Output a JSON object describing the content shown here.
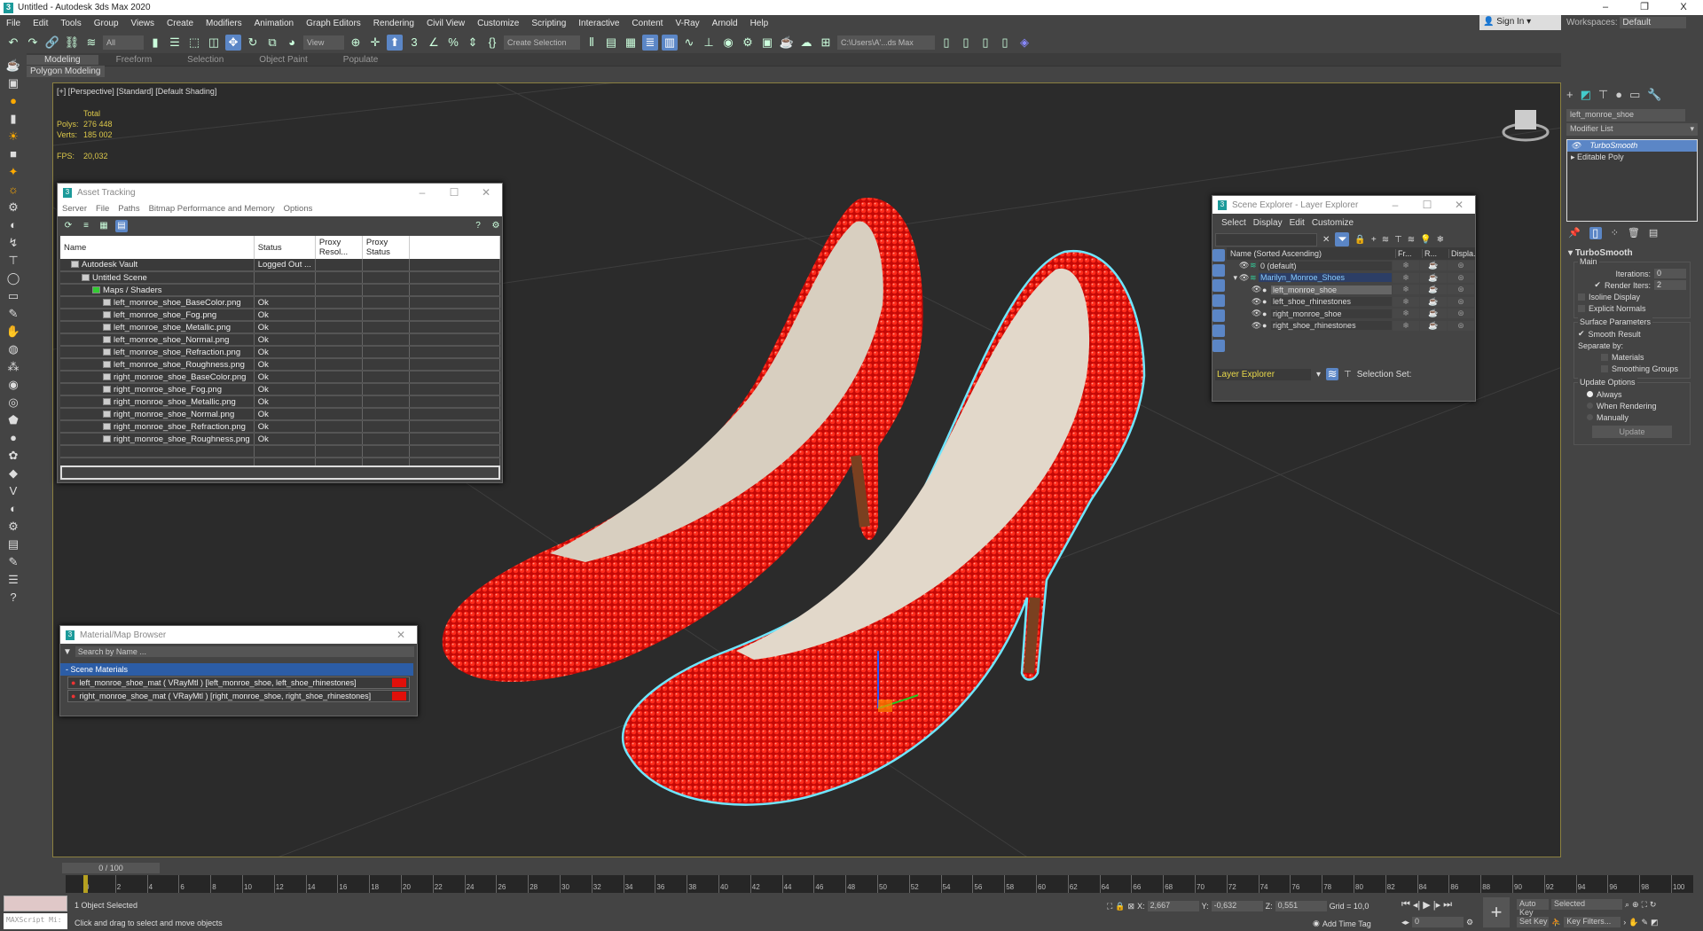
{
  "app": {
    "title": "Untitled - Autodesk 3ds Max 2020",
    "logo": "3",
    "controls": [
      "–",
      "❐",
      "X"
    ]
  },
  "menu": [
    "File",
    "Edit",
    "Tools",
    "Group",
    "Views",
    "Create",
    "Modifiers",
    "Animation",
    "Graph Editors",
    "Rendering",
    "Civil View",
    "Customize",
    "Scripting",
    "Interactive",
    "Content",
    "V-Ray",
    "Arnold",
    "Help"
  ],
  "account": {
    "sign_in": "Sign In",
    "workspaces_label": "Workspaces:",
    "workspace": "Default"
  },
  "toolbar": {
    "filter": "All",
    "ref_coord": "View",
    "selection_set": "Create Selection Se",
    "project_path": "C:\\Users\\A'...ds Max 2020"
  },
  "ribbon": {
    "tabs": [
      "Modeling",
      "Freeform",
      "Selection",
      "Object Paint",
      "Populate"
    ],
    "active": "Modeling",
    "sub": "Polygon Modeling"
  },
  "viewport": {
    "label": "[+] [Perspective] [Standard] [Default Shading]",
    "stats": {
      "header": "Total",
      "polys_label": "Polys:",
      "polys": "276 448",
      "verts_label": "Verts:",
      "verts": "185 002",
      "fps_label": "FPS:",
      "fps": "20,032"
    },
    "shoe_color": "#e0100a",
    "selection_outline": "#6fe6ff"
  },
  "asset_tracking": {
    "title": "Asset Tracking",
    "menu": [
      "Server",
      "File",
      "Paths",
      "Bitmap Performance and Memory",
      "Options"
    ],
    "columns": [
      "Name",
      "Status",
      "Proxy Resol...",
      "Proxy Status"
    ],
    "rows": [
      {
        "name": "Autodesk Vault",
        "status": "Logged Out ...",
        "level": 1
      },
      {
        "name": "Untitled Scene",
        "status": "",
        "level": 2
      },
      {
        "name": "Maps / Shaders",
        "status": "",
        "level": 3
      },
      {
        "name": "left_monroe_shoe_BaseColor.png",
        "status": "Ok",
        "level": 4
      },
      {
        "name": "left_monroe_shoe_Fog.png",
        "status": "Ok",
        "level": 4
      },
      {
        "name": "left_monroe_shoe_Metallic.png",
        "status": "Ok",
        "level": 4
      },
      {
        "name": "left_monroe_shoe_Normal.png",
        "status": "Ok",
        "level": 4
      },
      {
        "name": "left_monroe_shoe_Refraction.png",
        "status": "Ok",
        "level": 4
      },
      {
        "name": "left_monroe_shoe_Roughness.png",
        "status": "Ok",
        "level": 4
      },
      {
        "name": "right_monroe_shoe_BaseColor.png",
        "status": "Ok",
        "level": 4
      },
      {
        "name": "right_monroe_shoe_Fog.png",
        "status": "Ok",
        "level": 4
      },
      {
        "name": "right_monroe_shoe_Metallic.png",
        "status": "Ok",
        "level": 4
      },
      {
        "name": "right_monroe_shoe_Normal.png",
        "status": "Ok",
        "level": 4
      },
      {
        "name": "right_monroe_shoe_Refraction.png",
        "status": "Ok",
        "level": 4
      },
      {
        "name": "right_monroe_shoe_Roughness.png",
        "status": "Ok",
        "level": 4
      }
    ]
  },
  "scene_explorer": {
    "title": "Scene Explorer - Layer Explorer",
    "menu": [
      "Select",
      "Display",
      "Edit",
      "Customize"
    ],
    "columns": [
      "Name (Sorted Ascending)",
      "Fr...",
      "R...",
      "Displa..."
    ],
    "rows": [
      {
        "name": "0 (default)",
        "level": 0,
        "state": ""
      },
      {
        "name": "Marilyn_Monroe_Shoes",
        "level": 0,
        "state": "layer-active"
      },
      {
        "name": "left_monroe_shoe",
        "level": 1,
        "state": "selected"
      },
      {
        "name": "left_shoe_rhinestones",
        "level": 1,
        "state": ""
      },
      {
        "name": "right_monroe_shoe",
        "level": 1,
        "state": ""
      },
      {
        "name": "right_shoe_rhinestones",
        "level": 1,
        "state": ""
      }
    ],
    "explorer_type": "Layer Explorer",
    "selection_set_label": "Selection Set:"
  },
  "material_browser": {
    "title": "Material/Map Browser",
    "search_placeholder": "Search by Name ...",
    "group": "- Scene Materials",
    "items": [
      "left_monroe_shoe_mat  ( VRayMtl ) [left_monroe_shoe, left_shoe_rhinestones]",
      "right_monroe_shoe_mat  ( VRayMtl ) [right_monroe_shoe, right_shoe_rhinestones]"
    ]
  },
  "command_panel": {
    "object_name": "left_monroe_shoe",
    "modifier_list": "Modifier List",
    "stack": [
      "TurboSmooth",
      "Editable Poly"
    ],
    "rollout": "TurboSmooth",
    "main": "Main",
    "iterations_label": "Iterations:",
    "iterations": "0",
    "render_iters_label": "Render Iters:",
    "render_iters": "2",
    "render_iters_checked": true,
    "isoline": "Isoline Display",
    "explicit_normals": "Explicit Normals",
    "surface": "Surface Parameters",
    "smooth_result": "Smooth Result",
    "separate_by": "Separate by:",
    "materials": "Materials",
    "smoothing_groups": "Smoothing Groups",
    "update_options": "Update Options",
    "always": "Always",
    "when_rendering": "When Rendering",
    "manually": "Manually",
    "update": "Update"
  },
  "timeline": {
    "frame": "0 / 100",
    "start": 0,
    "end": 100,
    "label_step": 2
  },
  "status": {
    "selected": "1 Object Selected",
    "prompt": "Click and drag to select and move objects",
    "maxscript": "MAXScript Mi:",
    "x_label": "X:",
    "x": "2,667",
    "y_label": "Y:",
    "y": "-0,632",
    "z_label": "Z:",
    "z": "0,551",
    "grid": "Grid = 10,0",
    "add_time_tag": "Add Time Tag",
    "current_frame": "0",
    "auto_key": "Auto Key",
    "set_key": "Set Key",
    "key_mode": "Selected",
    "key_filters": "Key Filters..."
  }
}
